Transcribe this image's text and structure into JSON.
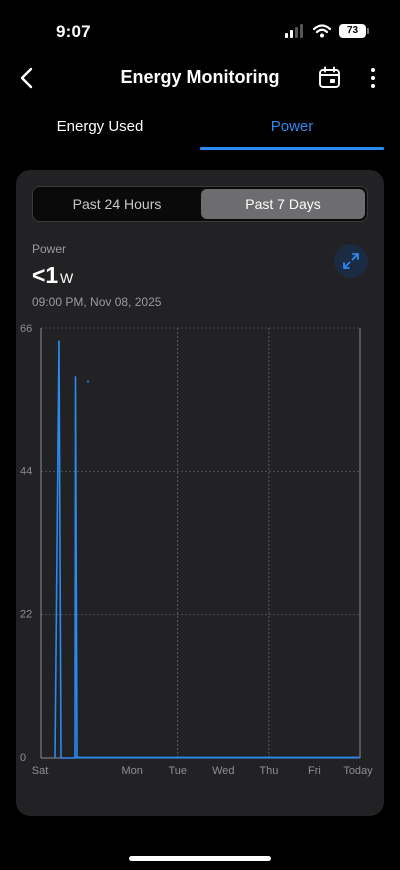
{
  "status_bar": {
    "time": "9:07",
    "battery": "73"
  },
  "nav": {
    "title": "Energy Monitoring",
    "back_icon": "chevron-left-icon",
    "calendar_icon": "calendar-icon",
    "more_icon": "more-vertical-icon"
  },
  "tabs": [
    {
      "label": "Energy Used",
      "active": false
    },
    {
      "label": "Power",
      "active": true
    }
  ],
  "range_selector": {
    "options": [
      "Past 24 Hours",
      "Past 7 Days"
    ],
    "selected": "Past 7 Days"
  },
  "metric": {
    "label": "Power",
    "value": "<1",
    "unit": "W",
    "timestamp": "09:00 PM, Nov 08, 2025"
  },
  "colors": {
    "accent": "#2a8af0",
    "background": "#000000",
    "card": "#222224"
  },
  "chart_data": {
    "type": "line",
    "x_ticks": [
      "Sat",
      "Mon",
      "Tue",
      "Wed",
      "Thu",
      "Fri",
      "Today"
    ],
    "y_ticks": [
      0,
      22,
      44,
      66
    ],
    "ylim": [
      0,
      66
    ],
    "grid": true,
    "series": [
      {
        "color": "#2a8af0",
        "points": [
          [
            "Sat",
            0
          ],
          [
            "Sat",
            0
          ],
          [
            "Sat",
            64
          ],
          [
            "Sat",
            0
          ],
          [
            "Sun",
            0
          ],
          [
            "Sun",
            59
          ],
          [
            "Sun",
            0
          ],
          [
            "Mon",
            0
          ],
          [
            "Tue",
            0
          ],
          [
            "Wed",
            0
          ],
          [
            "Thu",
            0
          ],
          [
            "Fri",
            0
          ],
          [
            "Today",
            0
          ]
        ]
      }
    ]
  }
}
